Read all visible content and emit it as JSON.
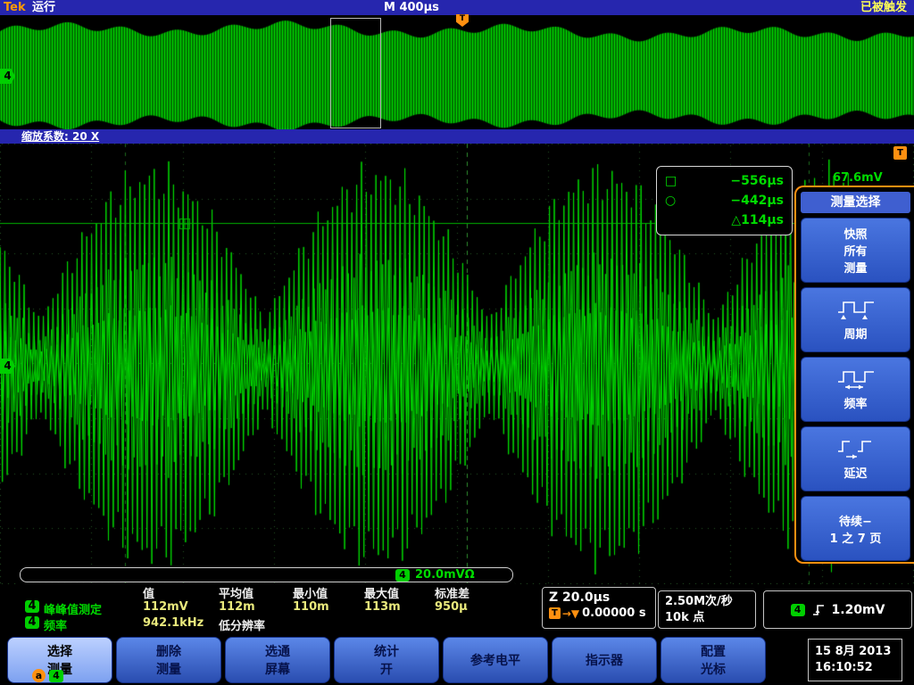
{
  "colors": {
    "accent_orange": "#ff9010",
    "waveform_green": "#00e000",
    "bar_blue": "#2626ae",
    "menu_blue": "#2a52c0",
    "status_yellow": "#ffff55"
  },
  "top_bar": {
    "brand": "Tek",
    "run_status": "运行",
    "timebase": "M 400µs",
    "trigger_status": "已被触发"
  },
  "overview": {
    "channel_badge": "4",
    "trigger_marker": "T"
  },
  "zoom_bar": {
    "label": "缩放系数: 20 X"
  },
  "main_view": {
    "channel_badge": "4",
    "trigger_marker": "T",
    "cursor_amplitude": "67.6mV"
  },
  "cursor_readout": {
    "cursor1_symbol": "□",
    "cursor1_value": "−556µs",
    "cursor2_symbol": "○",
    "cursor2_value": "−442µs",
    "delta_value": "△114µs"
  },
  "side_menu": {
    "title": "测量选择",
    "buttons": [
      {
        "label": "快照\n所有\n测量",
        "icon": ""
      },
      {
        "label": "周期",
        "icon": "period-waveform-icon"
      },
      {
        "label": "频率",
        "icon": "frequency-waveform-icon"
      },
      {
        "label": "延迟",
        "icon": "delay-waveform-icon"
      },
      {
        "label": "待续−\n1 之 7 页",
        "icon": ""
      }
    ]
  },
  "channel_readout": {
    "channel": "4",
    "value": "20.0mVΩ"
  },
  "measurements": {
    "headers": {
      "value": "值",
      "mean": "平均值",
      "min": "最小值",
      "max": "最大值",
      "stddev": "标准差"
    },
    "rows": [
      {
        "channel": "4",
        "name": "峰峰值测定",
        "value": "112mV",
        "mean": "112m",
        "min": "110m",
        "max": "113m",
        "stddev": "950µ"
      },
      {
        "channel": "4",
        "name": "频率",
        "value": "942.1kHz",
        "note": "低分辨率"
      }
    ]
  },
  "horizontal_readout": {
    "zoom_scale": "Z 20.0µs",
    "trigger_symbol": "T",
    "position_arrow": "→▼",
    "position": "0.00000 s"
  },
  "acquisition": {
    "sample_rate": "2.50M次/秒",
    "record_length": "10k 点"
  },
  "trigger_readout": {
    "channel": "4",
    "level": "1.20mV"
  },
  "bottom_menu": [
    {
      "label": "选择\n测量",
      "knob_a": "a",
      "knob_ch": "4"
    },
    {
      "label": "删除\n测量"
    },
    {
      "label": "选通\n屏幕"
    },
    {
      "label": "统计\n开"
    },
    {
      "label": "参考电平"
    },
    {
      "label": "指示器"
    },
    {
      "label": "配置\n光标"
    }
  ],
  "datetime": {
    "date": "15 8月 2013",
    "time": "16:10:52"
  }
}
